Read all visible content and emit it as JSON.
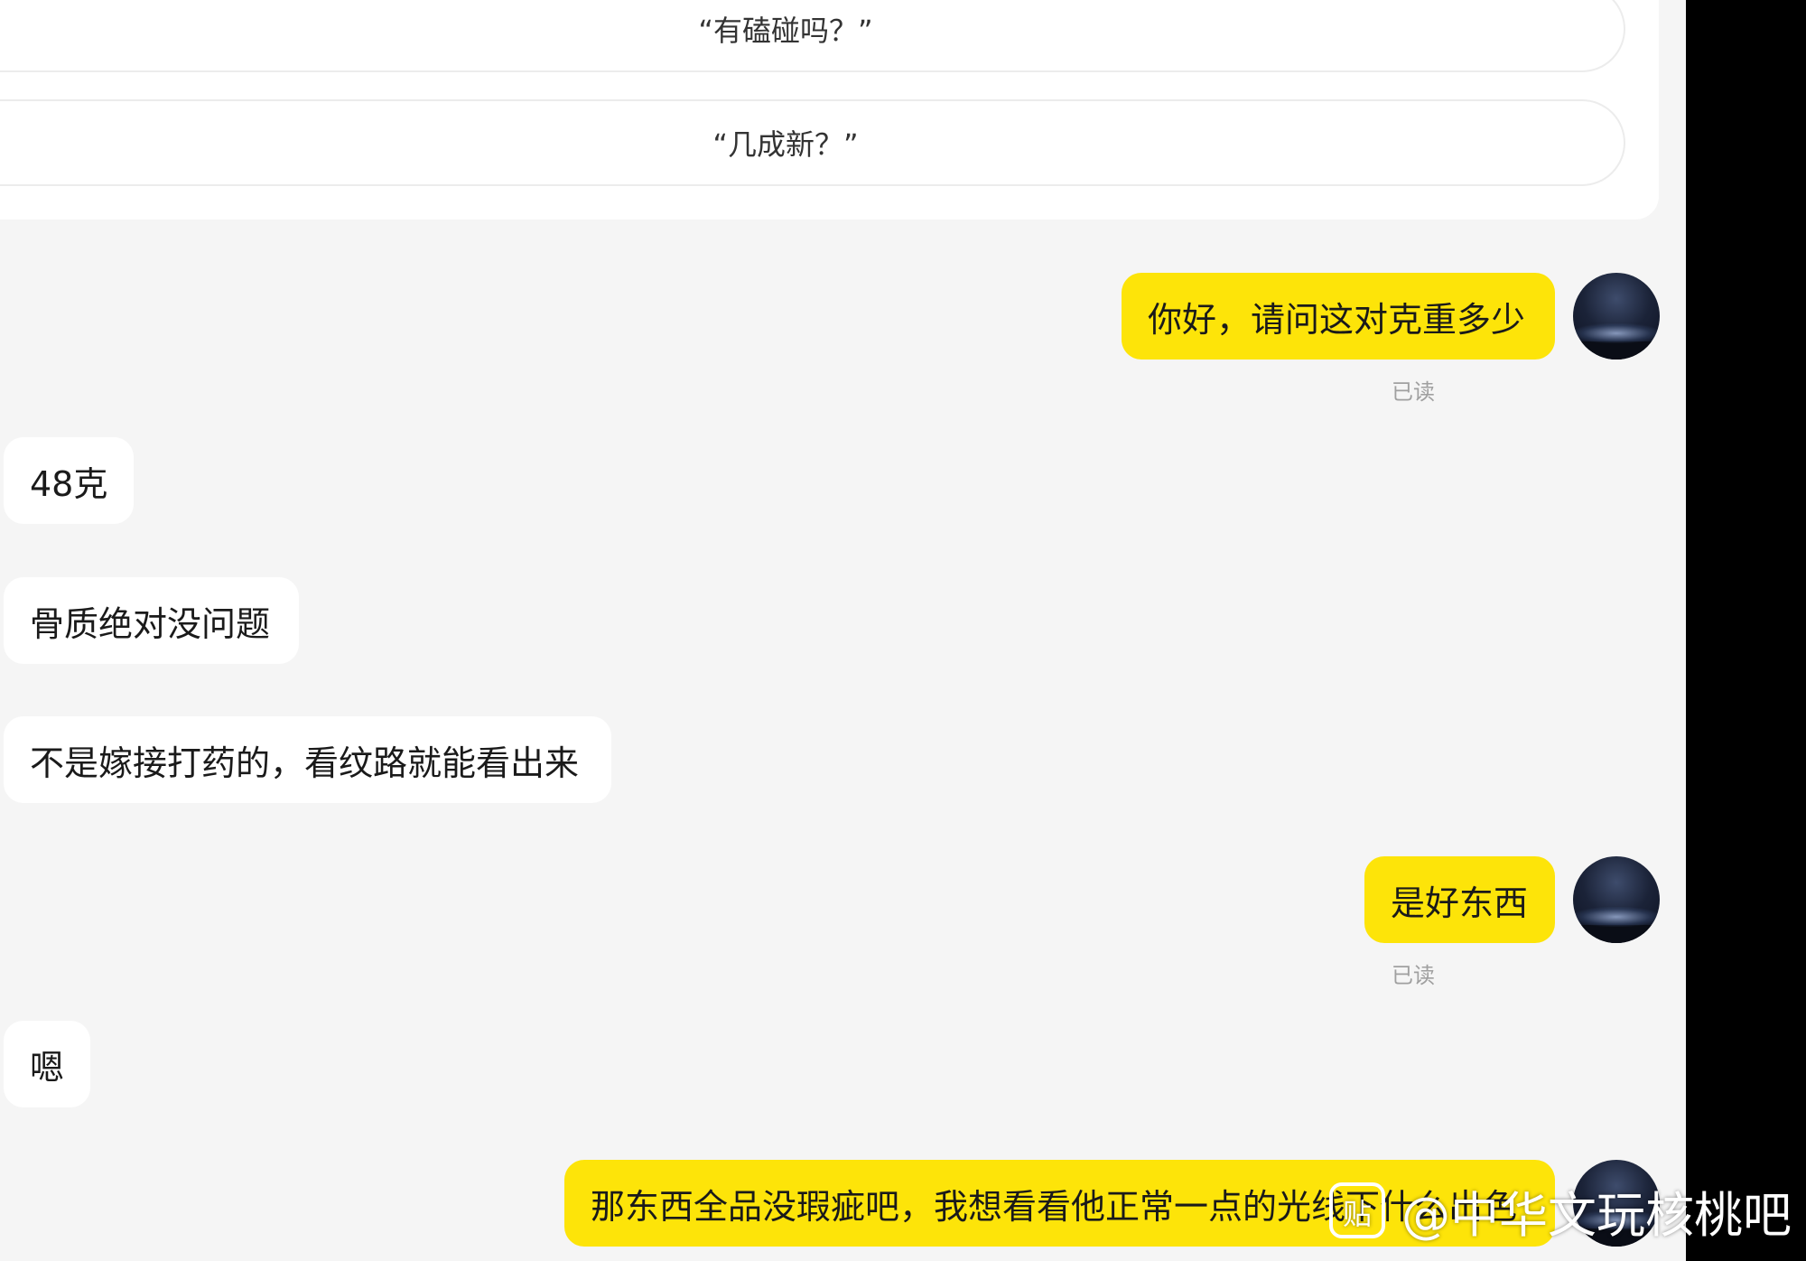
{
  "quick_questions": [
    "“有磕碰吗？”",
    "“几成新？”"
  ],
  "messages": [
    {
      "side": "out",
      "text": "你好，请问这对克重多少",
      "status": "已读"
    },
    {
      "side": "in",
      "text": "48克"
    },
    {
      "side": "in",
      "text": "骨质绝对没问题"
    },
    {
      "side": "in",
      "text": "不是嫁接打药的，看纹路就能看出来"
    },
    {
      "side": "out",
      "text": "是好东西",
      "status": "已读"
    },
    {
      "side": "in",
      "text": "嗯"
    },
    {
      "side": "out",
      "text": "那东西全品没瑕疵吧，我想看看他正常一点的光线下什么出色"
    }
  ],
  "watermark": {
    "icon": "tieba-icon",
    "text": "@中华文玩核桃吧"
  },
  "colors": {
    "outgoing_bubble": "#fde409",
    "incoming_bubble": "#ffffff",
    "background": "#f5f5f5"
  }
}
